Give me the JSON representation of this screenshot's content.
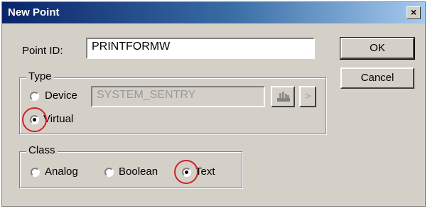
{
  "dialog": {
    "title": "New Point",
    "close_symbol": "×"
  },
  "point_id": {
    "label": "Point ID:",
    "value": "PRINTFORMW"
  },
  "buttons": {
    "ok": "OK",
    "cancel": "Cancel",
    "browse_icon": "device-browse-icon",
    "arrow": ">"
  },
  "type_group": {
    "caption": "Type",
    "device_label": "Device",
    "device_value": "SYSTEM_SENTRY",
    "virtual_label": "Virtual",
    "selected": "Virtual"
  },
  "class_group": {
    "caption": "Class",
    "analog_label": "Analog",
    "boolean_label": "Boolean",
    "text_label": "Text",
    "selected": "Text"
  },
  "annotations": {
    "highlight_color": "#d0202a"
  }
}
